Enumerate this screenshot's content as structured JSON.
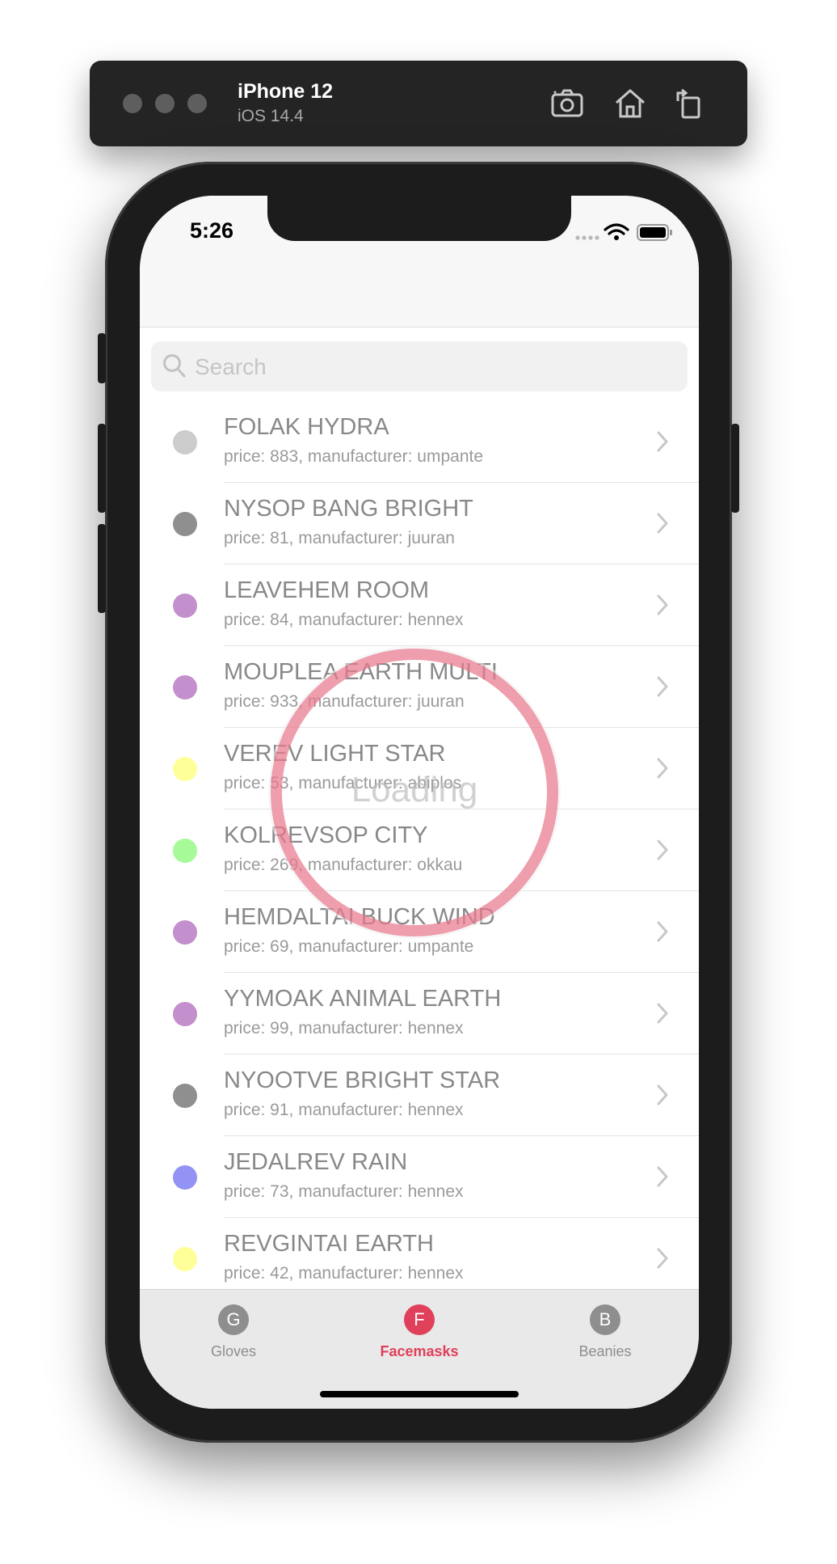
{
  "simulator": {
    "device_name": "iPhone 12",
    "os_version": "iOS 14.4",
    "buttons": [
      {
        "icon": "screenshot-icon"
      },
      {
        "icon": "home-icon"
      },
      {
        "icon": "rotate-icon"
      }
    ]
  },
  "status_bar": {
    "time": "5:26"
  },
  "search": {
    "placeholder": "Search"
  },
  "items": [
    {
      "name": "FOLAK HYDRA",
      "detail": "price: 883, manufacturer: umpante",
      "color": "#cccccc"
    },
    {
      "name": "NYSOP BANG BRIGHT",
      "detail": "price: 81, manufacturer: juuran",
      "color": "#8f8f8f"
    },
    {
      "name": "LEAVEHEM ROOM",
      "detail": "price: 84, manufacturer: hennex",
      "color": "#c38fcc"
    },
    {
      "name": "MOUPLEA EARTH MULTI",
      "detail": "price: 933, manufacturer: juuran",
      "color": "#c38fcc"
    },
    {
      "name": "VEREV LIGHT STAR",
      "detail": "price: 53, manufacturer: abiplos",
      "color": "#ffff99"
    },
    {
      "name": "KOLREVSOP CITY",
      "detail": "price: 269, manufacturer: okkau",
      "color": "#a6fa98"
    },
    {
      "name": "HEMDALTAI BUCK WIND",
      "detail": "price: 69, manufacturer: umpante",
      "color": "#c38fcc"
    },
    {
      "name": "YYMOAK ANIMAL EARTH",
      "detail": "price: 99, manufacturer: hennex",
      "color": "#c38fcc"
    },
    {
      "name": "NYOOTVE BRIGHT STAR",
      "detail": "price: 91, manufacturer: hennex",
      "color": "#8f8f8f"
    },
    {
      "name": "JEDALREV RAIN",
      "detail": "price: 73, manufacturer: hennex",
      "color": "#9393f5"
    },
    {
      "name": "REVGINTAI EARTH",
      "detail": "price: 42, manufacturer: hennex",
      "color": "#ffff99"
    }
  ],
  "loading": {
    "text": "Loading"
  },
  "tabs": [
    {
      "badge": "G",
      "label": "Gloves",
      "active": false
    },
    {
      "badge": "F",
      "label": "Facemasks",
      "active": true
    },
    {
      "badge": "B",
      "label": "Beanies",
      "active": false
    }
  ],
  "colors": {
    "accent": "#e0405a",
    "inactive_tab": "#8e8e8e",
    "inactive_badge": "#8e8e8e"
  }
}
